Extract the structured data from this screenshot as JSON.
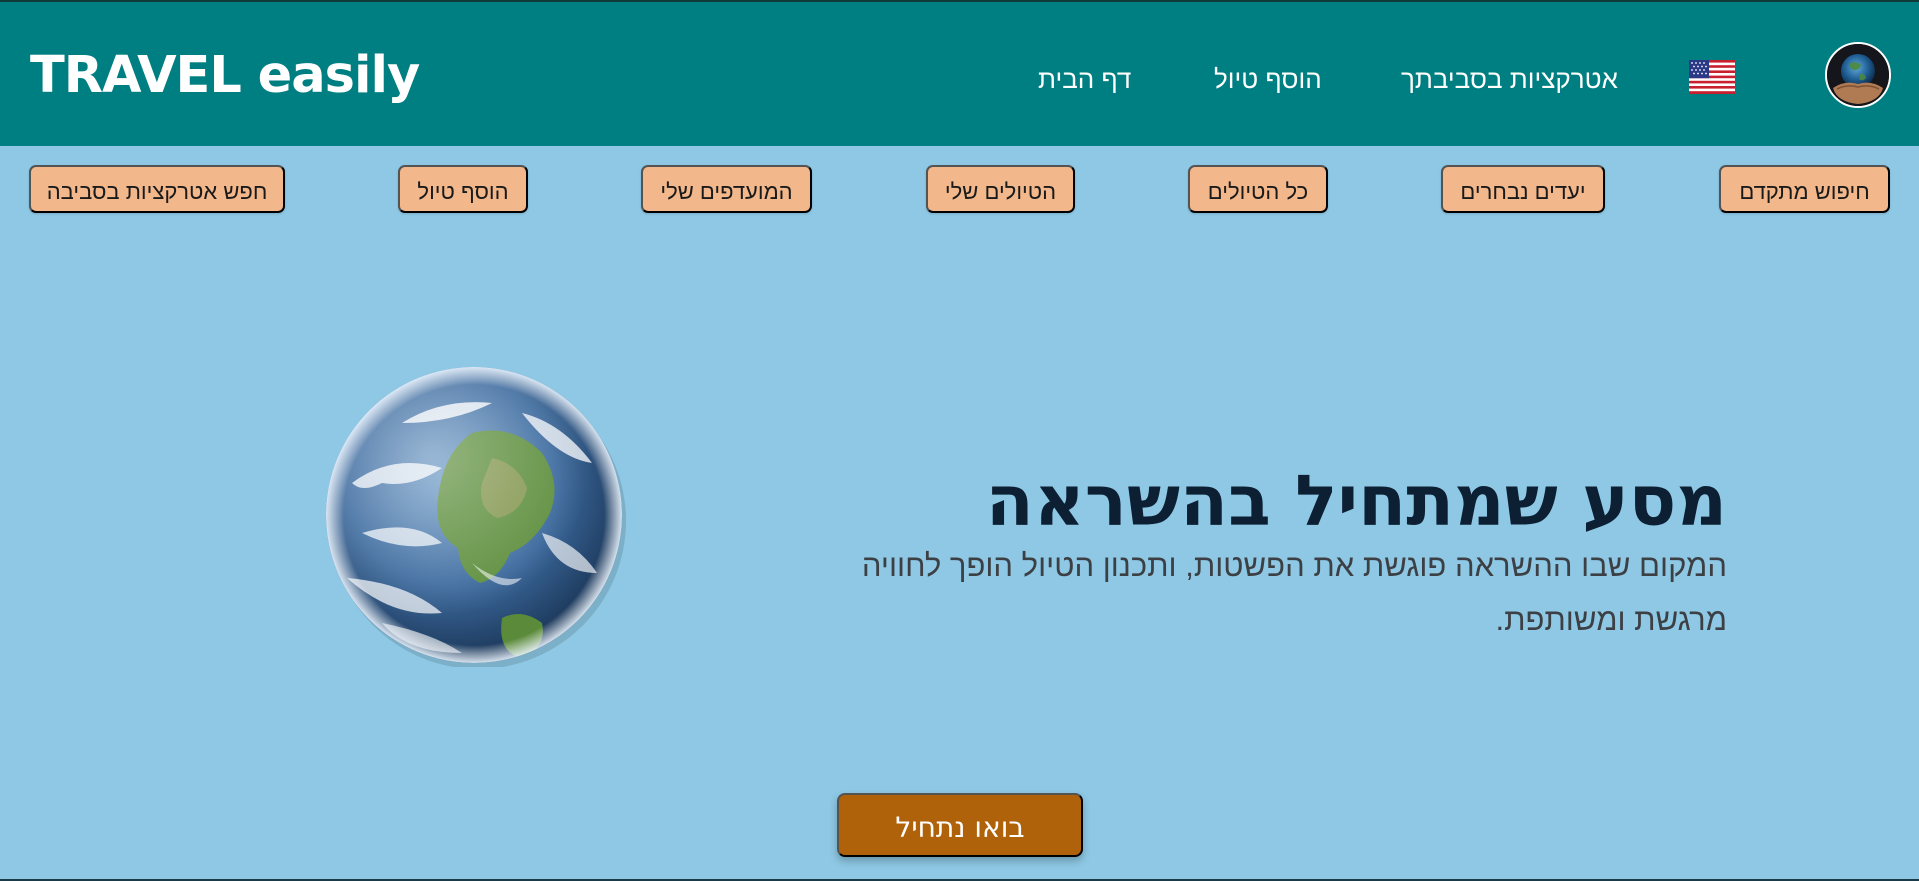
{
  "header": {
    "logo": "TRAVEL easily",
    "nav": {
      "home": "דף הבית",
      "add_trip": "הוסף טיול",
      "attractions": "אטרקציות בסביבתך"
    },
    "flag_icon": "us-flag-icon",
    "avatar_icon": "globe-in-hands-avatar"
  },
  "toolbar": {
    "advanced_search": "חיפוש מתקדם",
    "selected_destinations": "יעדים נבחרים",
    "all_trips": "כל הטיולים",
    "my_trips": "הטיולים שלי",
    "my_favorites": "המועדפים שלי",
    "add_trip": "הוסף טיול",
    "search_nearby": "חפש אטרקציות בסביבה"
  },
  "hero": {
    "title": "מסע שמתחיל בהשראה",
    "subtitle": "המקום שבו ההשראה פוגשת את הפשטות, ותכנון הטיול הופך לחוויה מרגשת ומשותפת.",
    "cta": "בואו נתחיל",
    "image": "earth-globe-image"
  },
  "colors": {
    "header_bg": "#007f82",
    "page_bg": "#8ec8e4",
    "pill_bg": "#f2b78a",
    "cta_bg": "#b0620a",
    "title_color": "#0c1f33"
  }
}
